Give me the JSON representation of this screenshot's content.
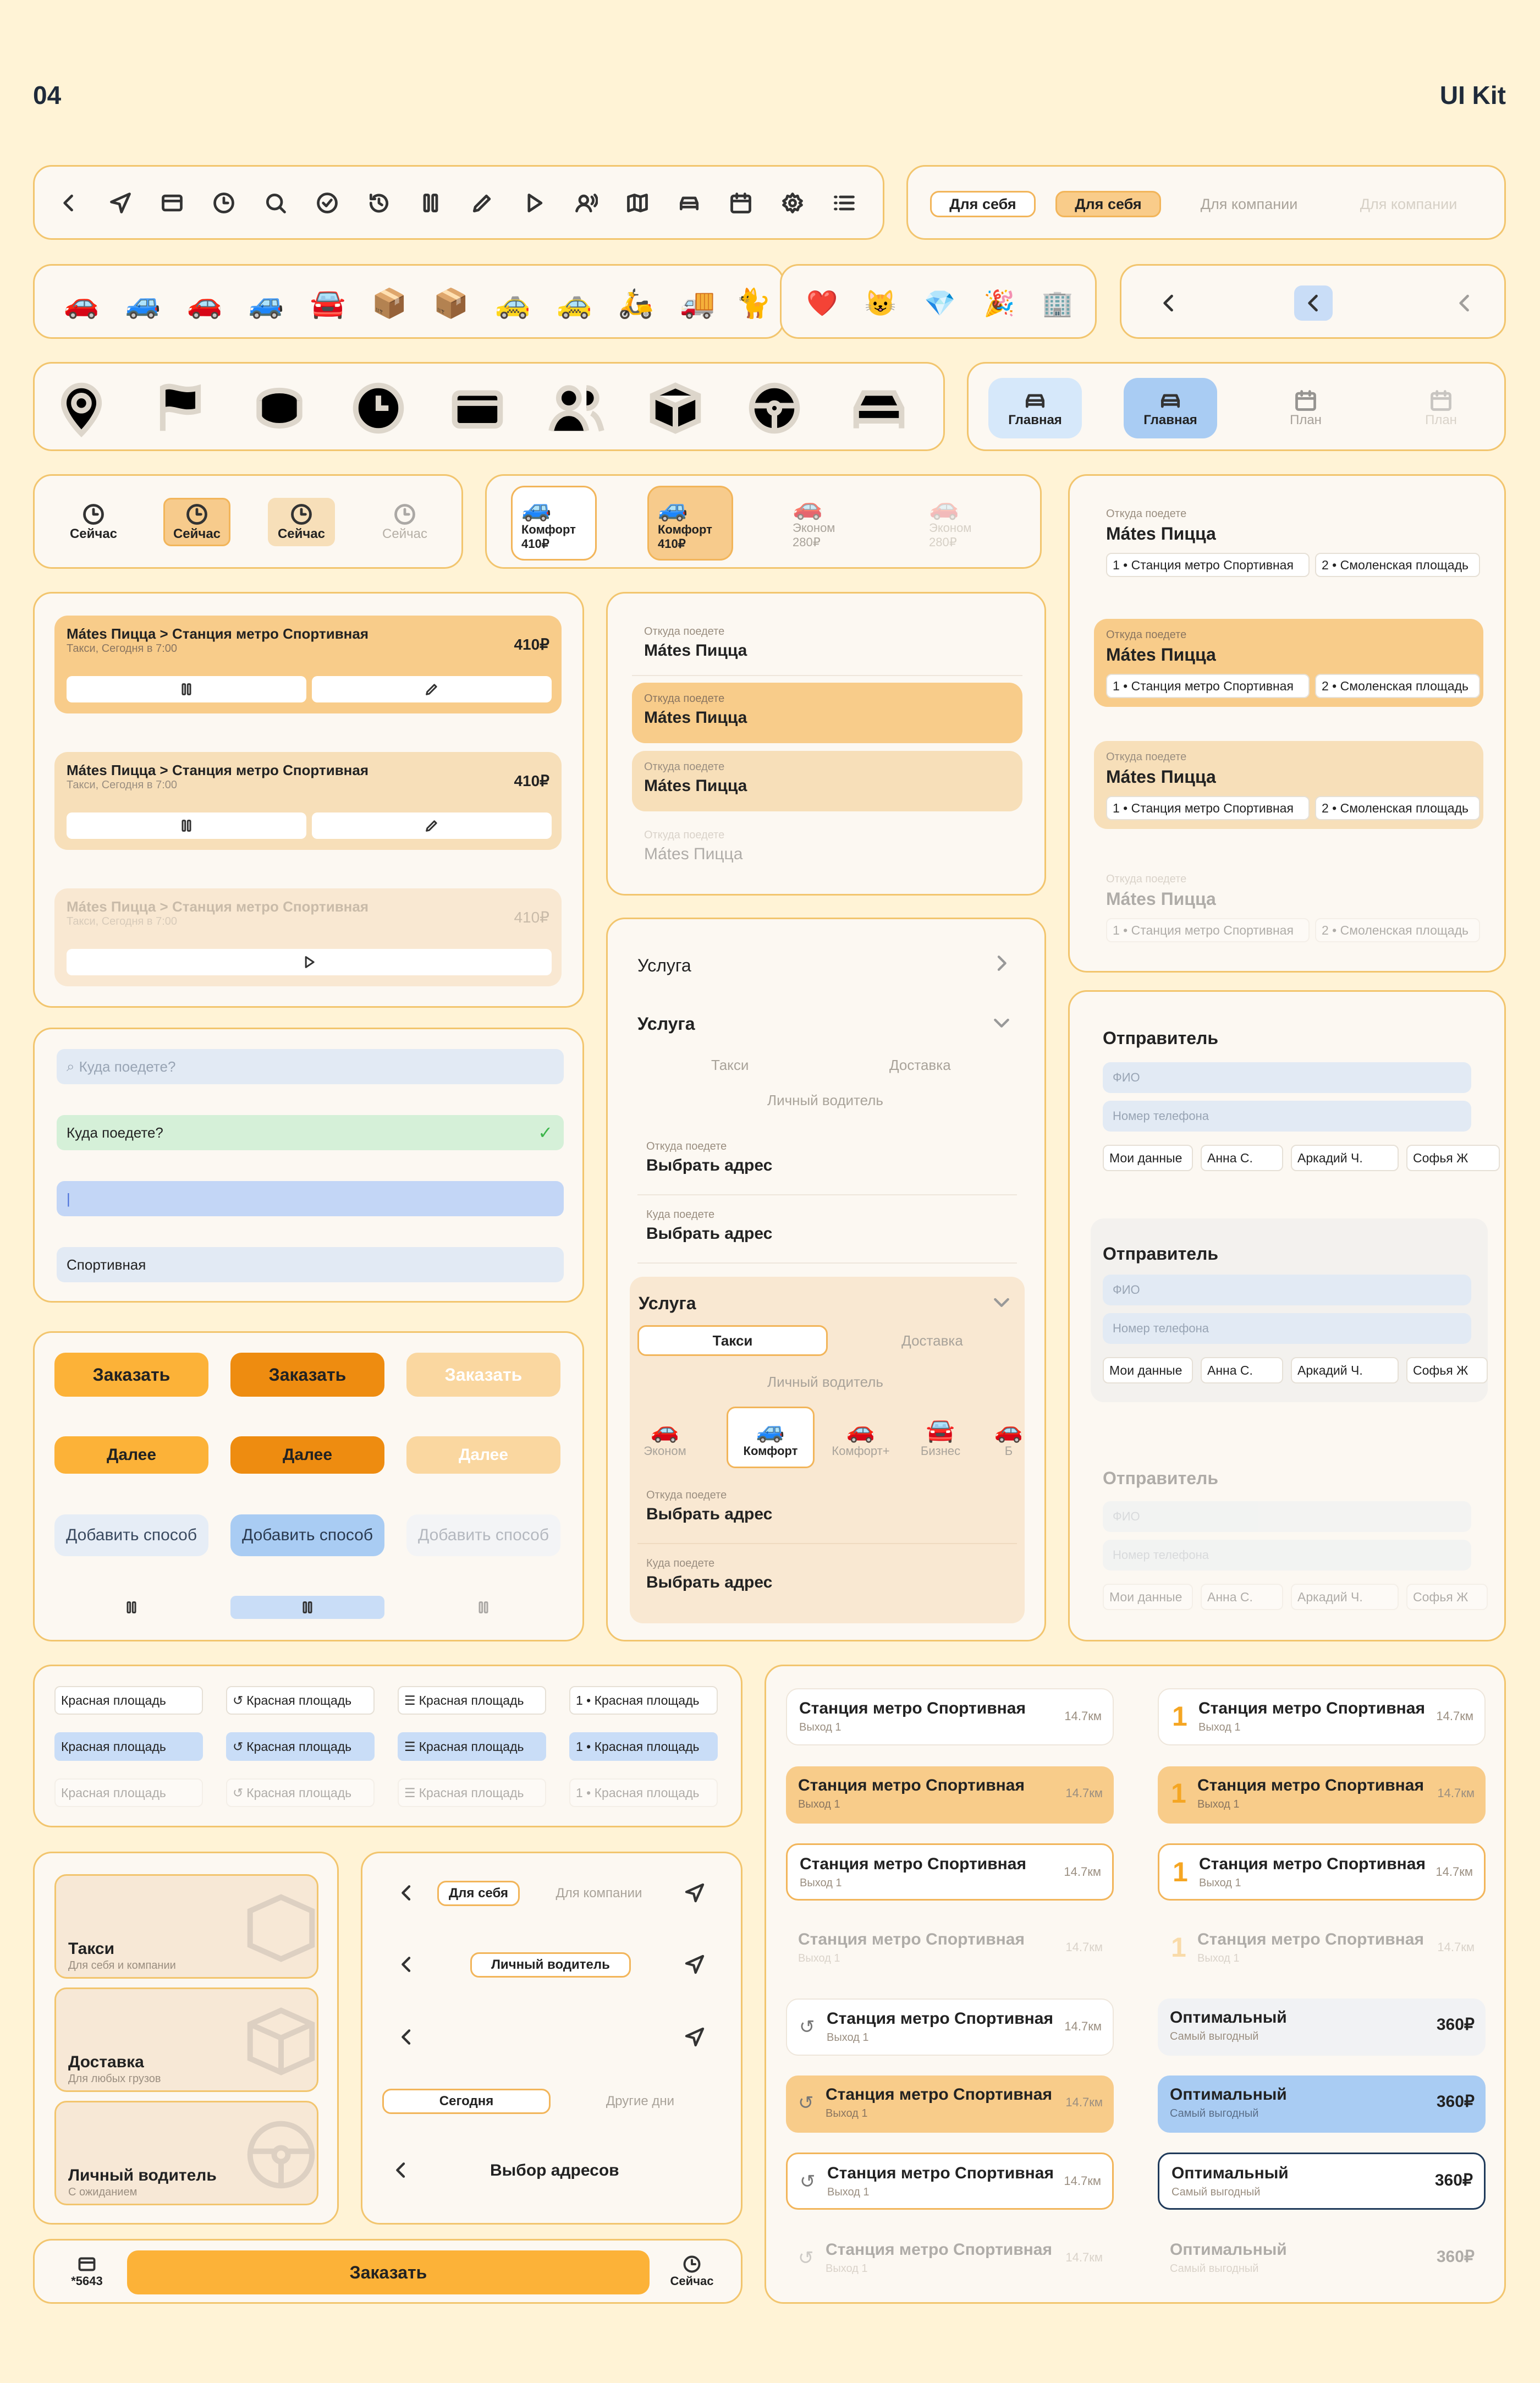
{
  "header": {
    "page_number": "04",
    "title": "UI Kit"
  },
  "icons_row": [
    "back-icon",
    "navigation-icon",
    "card-icon",
    "clock-icon",
    "search-icon",
    "check-circle-icon",
    "history-icon",
    "pause-icon",
    "pencil-icon",
    "play-icon",
    "voice-icon",
    "map-icon",
    "car-icon",
    "calendar-icon",
    "settings-icon",
    "list-icon"
  ],
  "for_whom": {
    "a": "Для себя",
    "b": "Для себя",
    "c": "Для компании",
    "d": "Для компании"
  },
  "car_glyphs": [
    "🚗",
    "🚙",
    "🚗",
    "🚙",
    "🚘",
    "📦",
    "📦",
    "🚕",
    "🚕",
    "🛵",
    "🚚",
    "🐈"
  ],
  "emoji": [
    "❤️",
    "😺",
    "💎",
    "🎉",
    "🏢"
  ],
  "tabs": {
    "home": "Главная",
    "plan": "План"
  },
  "now": "Сейчас",
  "tariffs": [
    {
      "name": "Комфорт",
      "price": "410₽"
    },
    {
      "name": "Комфорт",
      "price": "410₽"
    },
    {
      "name": "Эконом",
      "price": "280₽"
    },
    {
      "name": "Эконом",
      "price": "280₽"
    }
  ],
  "order": {
    "title": "Mátes Пицца > Станция метро Спортивная",
    "sub": "Такси, Сегодня в 7:00",
    "price": "410₽"
  },
  "from": {
    "label": "Откуда поедете",
    "value": "Mátes Пицца",
    "stop1": "1 • Станция метро Спортивная",
    "stop2": "2 • Смоленская площадь"
  },
  "service": {
    "title": "Услуга",
    "opt_taxi": "Такси",
    "opt_delivery": "Доставка",
    "opt_driver": "Личный водитель",
    "from_label": "Откуда поедете",
    "to_label": "Куда поедете",
    "choose": "Выбрать адрес"
  },
  "classes": [
    "Эконом",
    "Комфорт",
    "Комфорт+",
    "Бизнес",
    "Б"
  ],
  "search": {
    "placeholder": "Куда поедете?",
    "filled": "Куда поедете?",
    "cursor": "|",
    "value": "Спортивная"
  },
  "buttons": {
    "order": "Заказать",
    "next": "Далее",
    "add": "Добавить способ"
  },
  "sender": {
    "title": "Отправитель",
    "name": "ФИО",
    "phone": "Номер телефона",
    "mine": "Мои данные",
    "c1": "Анна С.",
    "c2": "Аркадий Ч.",
    "c3": "Софья Ж"
  },
  "place": "Красная площадь",
  "place_num": "1 • Красная площадь",
  "station": {
    "name": "Станция метро Спортивная",
    "exit": "Выход 1",
    "dist": "14.7км",
    "num": "1"
  },
  "optimal": {
    "name": "Оптимальный",
    "sub": "Самый выгодный",
    "price": "360₽"
  },
  "cats": [
    {
      "title": "Такси",
      "sub": "Для себя и компании"
    },
    {
      "title": "Доставка",
      "sub": "Для любых грузов"
    },
    {
      "title": "Личный водитель",
      "sub": "С ожиданием"
    }
  ],
  "nav": {
    "self": "Для себя",
    "company": "Для компании",
    "driver": "Личный водитель",
    "today": "Сегодня",
    "other": "Другие дни",
    "addresses": "Выбор адресов"
  },
  "bottom": {
    "card": "*5643",
    "order": "Заказать",
    "now": "Сейчас"
  }
}
